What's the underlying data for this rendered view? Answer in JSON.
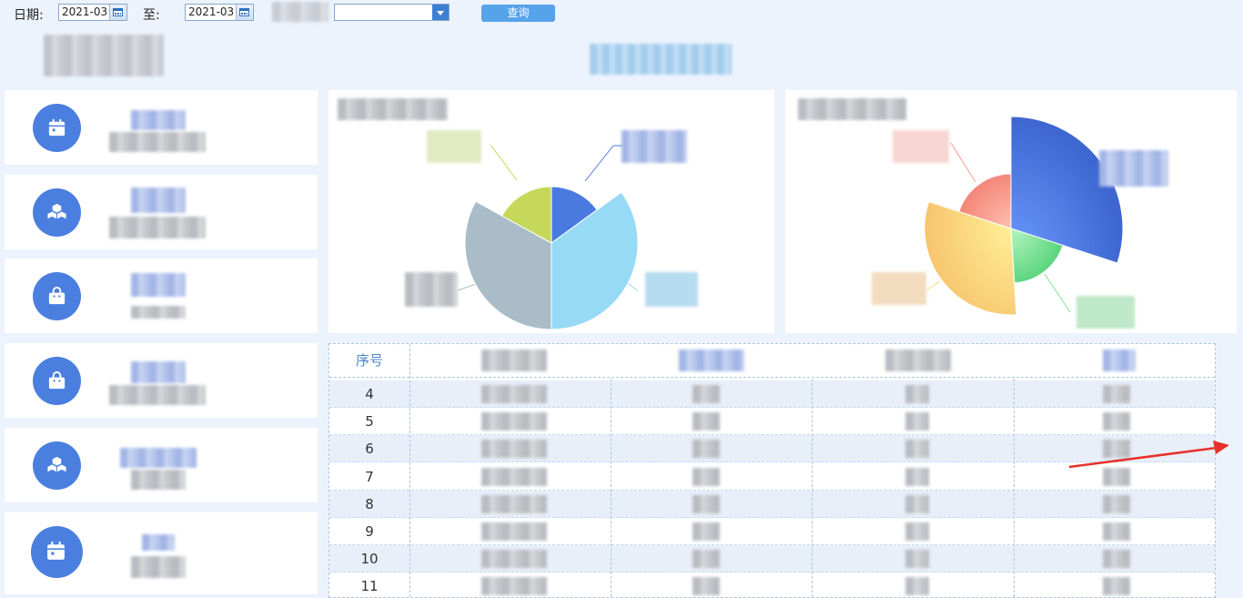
{
  "toolbar": {
    "date_label": "日期:",
    "start_date": "2021-03",
    "to_label": "至:",
    "end_date": "2021-03",
    "select_value": "",
    "query_label": "查询"
  },
  "colors": {
    "accent": "#4a7fe0",
    "background": "#ecf3fd",
    "query_button": "#57a3ea",
    "arrow": "#e8302a"
  },
  "cards": [
    {
      "icon": "calendar-icon"
    },
    {
      "icon": "cubes-icon"
    },
    {
      "icon": "bag-icon"
    },
    {
      "icon": "bag-icon"
    },
    {
      "icon": "cubes-icon"
    },
    {
      "icon": "calendar-icon"
    }
  ],
  "table": {
    "header_seq": "序号",
    "rows": [
      "4",
      "5",
      "6",
      "7",
      "8",
      "9",
      "10",
      "11"
    ]
  },
  "chart_data": [
    {
      "type": "pie",
      "title": "",
      "series": [
        {
          "values": [
            15,
            35,
            33,
            17
          ]
        }
      ],
      "colors": [
        "#4a7ae0",
        "#97daf6",
        "#a9bcc8",
        "#c5d85a"
      ]
    },
    {
      "type": "pie",
      "title": "",
      "series": [
        {
          "values": [
            30,
            19,
            31,
            20
          ]
        }
      ],
      "colors": [
        "#4f7ee4",
        "#80e49a",
        "#fbd97c",
        "#f79a8c"
      ]
    }
  ]
}
